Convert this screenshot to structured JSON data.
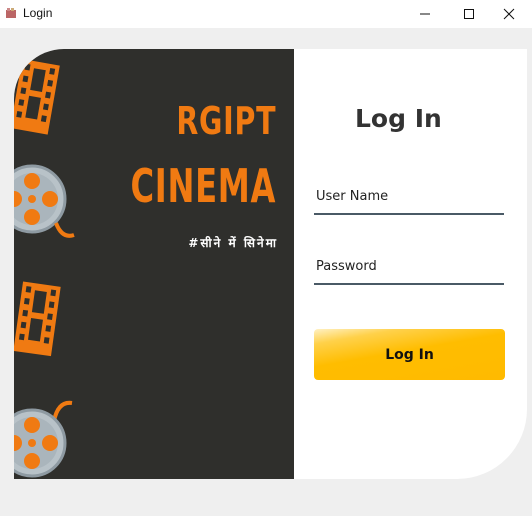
{
  "window": {
    "title": "Login",
    "icons": [
      "app-icon",
      "minimize-icon",
      "maximize-icon",
      "close-icon"
    ]
  },
  "brand": {
    "line1": "RGIPT",
    "line2": "CINEMA",
    "tagline": "#सीने में सिनेमा",
    "accent_color": "#f07a12",
    "panel_color": "#2f2f2c"
  },
  "form": {
    "heading": "Log In",
    "username_placeholder": "User Name",
    "password_placeholder": "Password",
    "submit_label": "Log In",
    "button_color": "#ffba00"
  },
  "decorations": [
    "film-strip-icon",
    "film-reel-icon",
    "film-strip-icon",
    "film-reel-icon"
  ]
}
